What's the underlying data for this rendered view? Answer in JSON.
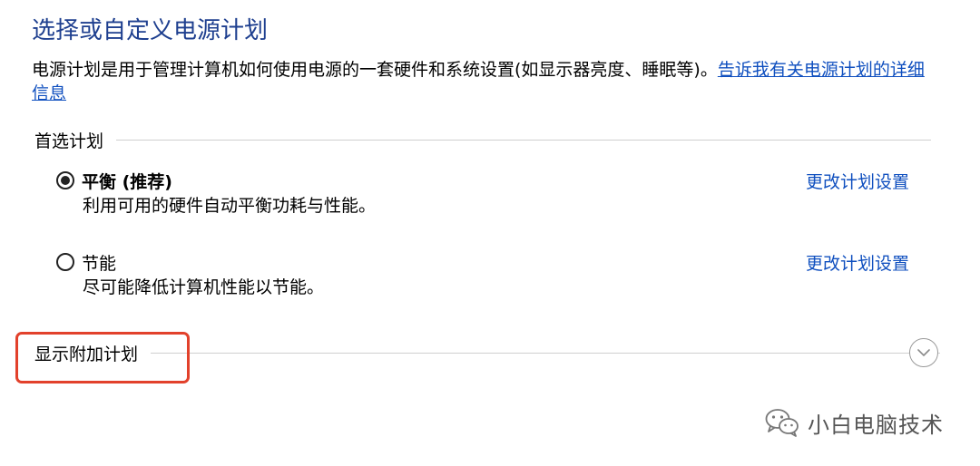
{
  "header": {
    "title": "选择或自定义电源计划",
    "description": "电源计划是用于管理计算机如何使用电源的一套硬件和系统设置(如显示器亮度、睡眠等)。",
    "learn_more_link": "告诉我有关电源计划的详细信息"
  },
  "preferred": {
    "label": "首选计划",
    "plans": [
      {
        "name": "平衡 (推荐)",
        "description": "利用可用的硬件自动平衡功耗与性能。",
        "change_link": "更改计划设置",
        "selected": true
      },
      {
        "name": "节能",
        "description": "尽可能降低计算机性能以节能。",
        "change_link": "更改计划设置",
        "selected": false
      }
    ]
  },
  "additional": {
    "label": "显示附加计划",
    "expand_icon": "chevron-down-icon"
  },
  "annotation": {
    "highlight_color": "#e2412b"
  },
  "watermark": {
    "text": "小白电脑技术",
    "icon": "wechat-icon"
  },
  "colors": {
    "title": "#1e3f8f",
    "link": "#0f4fbf"
  }
}
